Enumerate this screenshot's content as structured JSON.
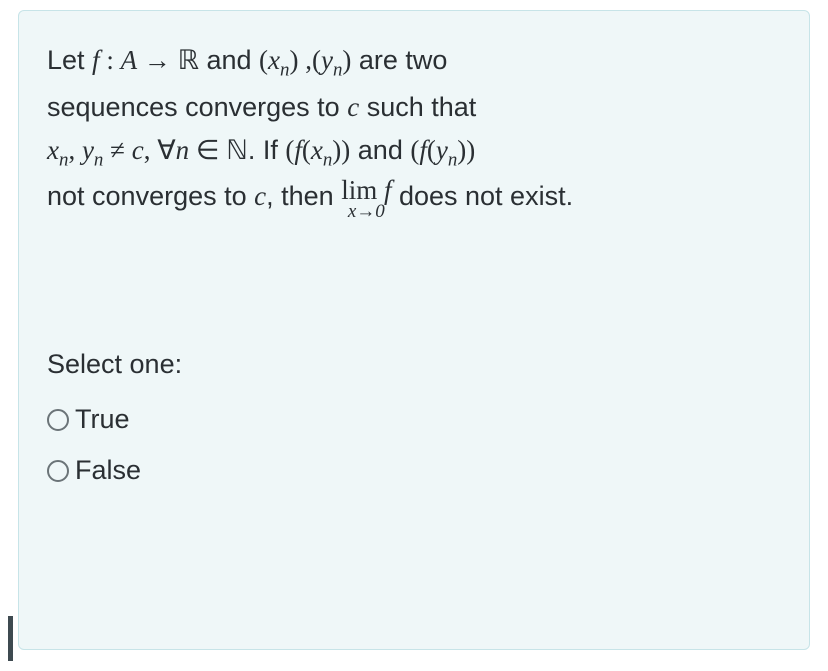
{
  "question": {
    "t1": "Let ",
    "f": "f",
    "colon": " : ",
    "A": "A",
    "arrow": " → ",
    "R": "ℝ",
    "t2": " and ",
    "lp1": "(",
    "x": "x",
    "n": "n",
    "rp1": ")",
    "comma1": " ,",
    "lp2": "(",
    "y": "y",
    "rp2": ")",
    "t3": " are two",
    "t4": "sequences converges to ",
    "c": "c",
    "t5": " such that",
    "xn": "x",
    "cm2": ", ",
    "yn": "y",
    "neq": " ≠ ",
    "cc": "c",
    "cm3": ", ",
    "forall": "∀",
    "nn": "n",
    "in": " ∈ ",
    "N": "ℕ",
    "t6": ". If ",
    "lp3": "(",
    "ff": "f",
    "lp4": "(",
    "xx": "x",
    "rp3": "))",
    "t7": " and ",
    "lp5": "(",
    "fff": "f",
    "lp6": "(",
    "yy": "y",
    "rp4": "))",
    "t8": "not converges to ",
    "ccc": "c",
    "cm4": ", then ",
    "lim": "lim",
    "limf": " f",
    "limsub": "x→0",
    "t9": " does not exist."
  },
  "select_label": "Select one:",
  "options": {
    "true": "True",
    "false": "False"
  }
}
